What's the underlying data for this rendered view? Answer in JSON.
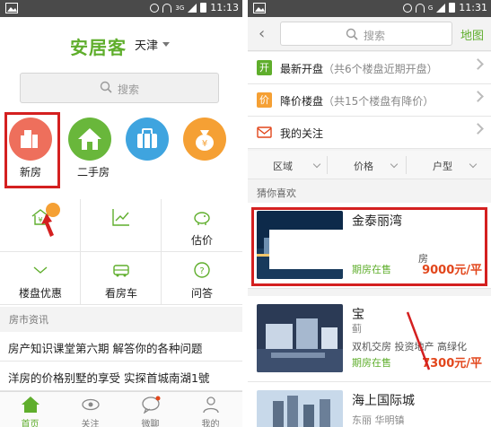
{
  "left": {
    "status": {
      "time": "11:13",
      "network": "3G"
    },
    "header": {
      "logo": "安居客",
      "city": "天津"
    },
    "search": {
      "placeholder": "搜索"
    },
    "categories": [
      {
        "label": "新房",
        "icon": "building-icon",
        "color": "#ee6f5c"
      },
      {
        "label": "二手房",
        "icon": "house-icon",
        "color": "#69b73b"
      },
      {
        "label": "",
        "icon": "briefcase-icon",
        "color": "#3fa4df"
      },
      {
        "label": "",
        "icon": "money-bag-icon",
        "color": "#f5a034"
      }
    ],
    "grid": [
      {
        "label": "",
        "icon": "yuan-house-icon"
      },
      {
        "label": "",
        "icon": "trend-chart-icon"
      },
      {
        "label": "估价",
        "icon": "piggy-bank-icon"
      },
      {
        "label": "楼盘优惠",
        "icon": "discount-icon"
      },
      {
        "label": "看房车",
        "icon": "bus-icon"
      },
      {
        "label": "问答",
        "icon": "question-icon"
      }
    ],
    "news_section": "房市资讯",
    "news": [
      "房产知识课堂第六期 解答你的各种问题",
      "洋房的价格别墅的享受 实探首城南湖1號"
    ],
    "tabs": [
      {
        "label": "首页",
        "icon": "home-icon",
        "active": true
      },
      {
        "label": "关注",
        "icon": "eye-icon",
        "active": false
      },
      {
        "label": "微聊",
        "icon": "chat-icon",
        "active": false
      },
      {
        "label": "我的",
        "icon": "person-icon",
        "active": false
      }
    ]
  },
  "right": {
    "status": {
      "time": "11:31",
      "network": "G"
    },
    "search": {
      "placeholder": "搜索",
      "map": "地图"
    },
    "rows": [
      {
        "badge": "开",
        "badge_color": "#5fae2c",
        "title": "最新开盘",
        "sub": "（共6个楼盘近期开盘）"
      },
      {
        "badge": "价",
        "badge_color": "#f5a034",
        "title": "降价楼盘",
        "sub": "（共15个楼盘有降价）"
      },
      {
        "badge": "",
        "badge_color": "#e2461b",
        "title": "我的关注",
        "sub": ""
      }
    ],
    "filters": [
      "区域",
      "价格",
      "户型",
      ""
    ],
    "guess_label": "猜你喜欢",
    "listings": [
      {
        "name": "金泰丽湾",
        "area": "",
        "tags": "房",
        "status": "期房在售",
        "price": "9000元/平"
      },
      {
        "name": "宝",
        "area": "蓟",
        "tags": "双机交房 投资地产 高绿化",
        "status": "期房在售",
        "price": "7300元/平"
      },
      {
        "name": "海上国际城",
        "area": "东丽 华明镇",
        "tags": "",
        "status": "",
        "price": ""
      }
    ]
  }
}
